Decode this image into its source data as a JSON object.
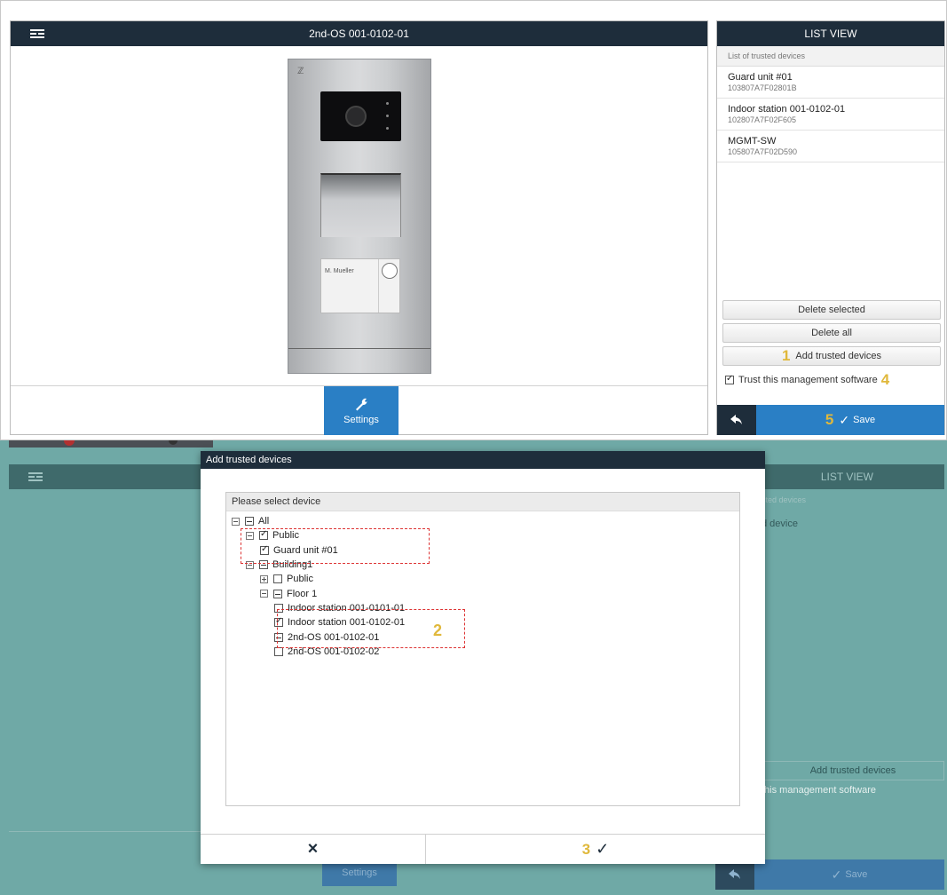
{
  "top": {
    "window_title": "2nd-OS 001-0102-01",
    "namebox_text": "M. Mueller",
    "settings_label": "Settings",
    "list_view": {
      "title": "LIST VIEW",
      "subtitle": "List of trusted devices",
      "items": [
        {
          "name": "Guard unit #01",
          "id": "103807A7F02801B"
        },
        {
          "name": "Indoor station 001-0102-01",
          "id": "102807A7F02F605"
        },
        {
          "name": "MGMT-SW",
          "id": "105807A7F02D590"
        }
      ],
      "delete_selected": "Delete selected",
      "delete_all": "Delete all",
      "add_trusted": "Add trusted devices",
      "trust_mgmt": "Trust this management software",
      "save": "Save",
      "step1": "1",
      "step4": "4",
      "step5": "5"
    }
  },
  "bottom": {
    "dialog_title": "Add trusted devices",
    "select_label": "Please select device",
    "tree": [
      {
        "label": "All",
        "level": 0,
        "expander": "minus",
        "check": "partial"
      },
      {
        "label": "Public",
        "level": 1,
        "expander": "minus",
        "check": "checked"
      },
      {
        "label": "Guard unit #01",
        "level": 2,
        "expander": "none",
        "check": "checked"
      },
      {
        "label": "Building1",
        "level": 1,
        "expander": "minus",
        "check": "partial"
      },
      {
        "label": "Public",
        "level": 2,
        "expander": "plus",
        "check": "unchecked"
      },
      {
        "label": "Floor 1",
        "level": 2,
        "expander": "minus",
        "check": "partial"
      },
      {
        "label": "Indoor station 001-0101-01",
        "level": 3,
        "expander": "none",
        "check": "unchecked"
      },
      {
        "label": "Indoor station 001-0102-01",
        "level": 3,
        "expander": "none",
        "check": "checked"
      },
      {
        "label": "2nd-OS 001-0102-01",
        "level": 3,
        "expander": "none",
        "check": "partial"
      },
      {
        "label": "2nd-OS 001-0102-02",
        "level": 3,
        "expander": "none",
        "check": "unchecked"
      }
    ],
    "step2": "2",
    "step3": "3",
    "cancel_icon": "×",
    "confirm_icon": "✓",
    "bg_list_view": "LIST VIEW",
    "bg_sted_devices": "sted devices",
    "bg_d_device": "d device",
    "bg_add_trusted": "Add trusted devices",
    "bg_mgmt": "this management software",
    "bg_save": "Save",
    "bg_settings": "Settings"
  },
  "colors": {
    "titlebar": "#1e2d3b",
    "accent_blue": "#2a7fc5",
    "step_number": "#e0b83b",
    "overlay_teal": "#6fa9a6",
    "dash_red": "#dd3333"
  }
}
